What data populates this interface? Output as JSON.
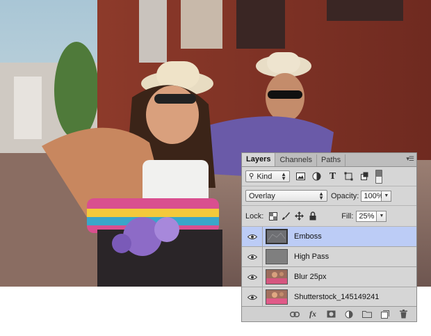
{
  "panel": {
    "tabs": [
      "Layers",
      "Channels",
      "Paths"
    ],
    "active_tab": "Layers",
    "filter": {
      "value": "Kind"
    },
    "blend_mode": "Overlay",
    "opacity_label": "Opacity:",
    "opacity_value": "100%",
    "lock_label": "Lock:",
    "fill_label": "Fill:",
    "fill_value": "25%",
    "layers": [
      {
        "name": "Emboss",
        "selected": true,
        "visible": true,
        "thumb": "gray-texture"
      },
      {
        "name": "High Pass",
        "selected": false,
        "visible": true,
        "thumb": "gray"
      },
      {
        "name": "Blur 25px",
        "selected": false,
        "visible": true,
        "thumb": "photo"
      },
      {
        "name": "Shutterstock_145149241",
        "selected": false,
        "visible": true,
        "thumb": "photo"
      }
    ],
    "bottom_icons": [
      "link-icon",
      "fx-icon",
      "mask-icon",
      "adjustment-icon",
      "folder-icon",
      "new-layer-icon",
      "trash-icon"
    ],
    "colors": {
      "selection": "#bcccf6",
      "panel_bg": "#d6d6d6"
    }
  }
}
